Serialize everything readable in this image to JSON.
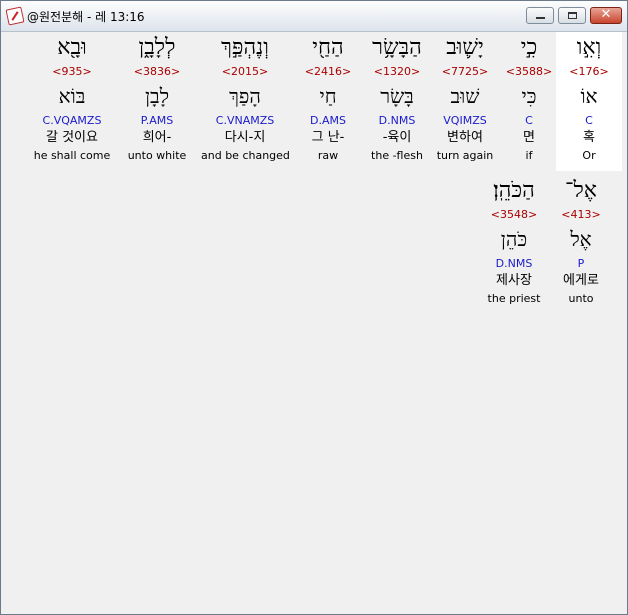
{
  "window": {
    "title": "@원전분해 - 레 13:16"
  },
  "rows": [
    [
      {
        "hebrew": "וְאִ֣ו",
        "strong": "<176>",
        "lemma": "אוֹ",
        "morph": "C",
        "korean": "혹",
        "english": "Or",
        "highlighted": true
      },
      {
        "hebrew": "כִ֣י",
        "strong": "<3588>",
        "lemma": "כִּי",
        "morph": "C",
        "korean": "면",
        "english": "if",
        "highlighted": false
      },
      {
        "hebrew": "יָשׁ֛וּב",
        "strong": "<7725>",
        "lemma": "שׁוּב",
        "morph": "VQIMZS",
        "korean": "변하여",
        "english": "turn again",
        "highlighted": false
      },
      {
        "hebrew": "הַבָּשָׂ֥ר",
        "strong": "<1320>",
        "lemma": "בָּשָׂר",
        "morph": "D.NMS",
        "korean": "-육이",
        "english": "the -flesh",
        "highlighted": false
      },
      {
        "hebrew": "הַחַ֖י",
        "strong": "<2416>",
        "lemma": "חַי",
        "morph": "D.AMS",
        "korean": "그 난-",
        "english": "raw",
        "highlighted": false
      },
      {
        "hebrew": "וְנֶהְפַּ֣ךְ",
        "strong": "<2015>",
        "lemma": "הָפַךְ",
        "morph": "C.VNAMZS",
        "korean": "다시-지",
        "english": "and be changed",
        "highlighted": false
      },
      {
        "hebrew": "לְלָבָ֑ן",
        "strong": "<3836>",
        "lemma": "לָבָן",
        "morph": "P.AMS",
        "korean": "희어-",
        "english": "unto white",
        "highlighted": false
      },
      {
        "hebrew": "וּבָ֖א",
        "strong": "<935>",
        "lemma": "בּוֹא",
        "morph": "C.VQAMZS",
        "korean": "갈 것이요",
        "english": "he shall come",
        "highlighted": false
      }
    ],
    [
      {
        "hebrew": "אֶל־",
        "strong": "<413>",
        "lemma": "אֶל",
        "morph": "P",
        "korean": "에게로",
        "english": "unto",
        "highlighted": false
      },
      {
        "hebrew": "הַכֹּהֵֽן׃",
        "strong": "<3548>",
        "lemma": "כֹּהֵן",
        "morph": "D.NMS",
        "korean": "제사장",
        "english": "the priest",
        "highlighted": false
      }
    ]
  ]
}
